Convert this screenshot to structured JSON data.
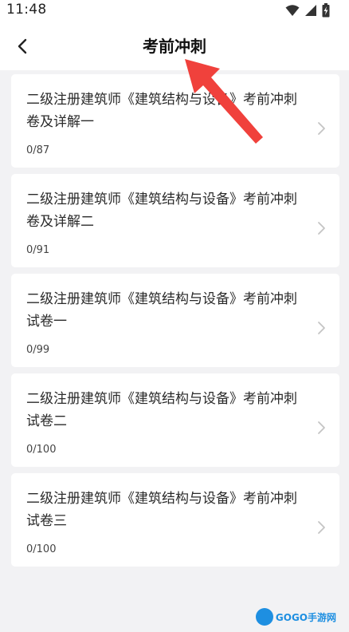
{
  "status_bar": {
    "time": "11:48",
    "icons": [
      "wifi-icon",
      "cellular-signal-icon",
      "battery-icon"
    ]
  },
  "header": {
    "title": "考前冲刺",
    "back_icon": "chevron-left-icon"
  },
  "exams": [
    {
      "title": "二级注册建筑师《建筑结构与设备》考前冲刺卷及详解一",
      "progress": "0/87"
    },
    {
      "title": "二级注册建筑师《建筑结构与设备》考前冲刺卷及详解二",
      "progress": "0/91"
    },
    {
      "title": "二级注册建筑师《建筑结构与设备》考前冲刺试卷一",
      "progress": "0/99"
    },
    {
      "title": "二级注册建筑师《建筑结构与设备》考前冲刺试卷二",
      "progress": "0/100"
    },
    {
      "title": "二级注册建筑师《建筑结构与设备》考前冲刺试卷三",
      "progress": "0/100"
    }
  ],
  "watermark": {
    "text": "GOGO手游网"
  },
  "colors": {
    "background": "#f2f2f4",
    "card": "#ffffff",
    "annotation_arrow": "#f0413c"
  }
}
